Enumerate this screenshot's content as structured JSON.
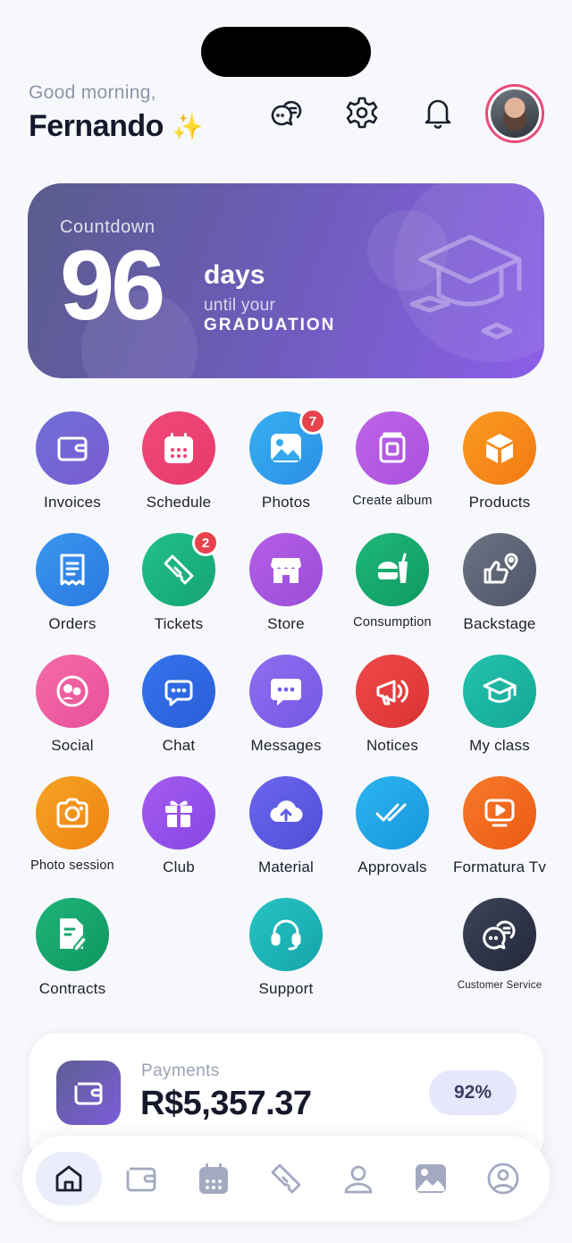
{
  "header": {
    "greeting": "Good morning,",
    "user_name": "Fernando",
    "sparkle": "✨",
    "icons": [
      "chat-bubbles-icon",
      "settings-icon",
      "bell-icon"
    ]
  },
  "countdown": {
    "label": "Countdown",
    "number": "96",
    "unit": "days",
    "until": "until your",
    "event": "GRADUATION"
  },
  "apps": [
    {
      "label": "Invoices",
      "icon": "wallet-icon",
      "color_from": "#6f6fd6",
      "color_to": "#7a5bd2"
    },
    {
      "label": "Schedule",
      "icon": "calendar-icon",
      "color_from": "#f0487a",
      "color_to": "#e83a6b"
    },
    {
      "label": "Photos",
      "icon": "image-icon",
      "color_from": "#35b0f1",
      "color_to": "#2c8ee6",
      "badge": "7"
    },
    {
      "label": "Create album",
      "icon": "album-icon",
      "color_from": "#c064e8",
      "color_to": "#a851dc"
    },
    {
      "label": "Products",
      "icon": "box-icon",
      "color_from": "#fb9a22",
      "color_to": "#f27a12"
    },
    {
      "label": "Orders",
      "icon": "receipt-icon",
      "color_from": "#3a97ef",
      "color_to": "#2b78e0"
    },
    {
      "label": "Tickets",
      "icon": "ticket-icon",
      "color_from": "#22c08a",
      "color_to": "#15a472",
      "badge": "2"
    },
    {
      "label": "Store",
      "icon": "storefront-icon",
      "color_from": "#b55ee6",
      "color_to": "#9a4ed8"
    },
    {
      "label": "Consumption",
      "icon": "food-icon",
      "color_from": "#1fb77a",
      "color_to": "#0f9a62"
    },
    {
      "label": "Backstage",
      "icon": "thumbs-location-icon",
      "color_from": "#6c7384",
      "color_to": "#4e5566"
    },
    {
      "label": "Social",
      "icon": "social-icon",
      "color_from": "#f56ba8",
      "color_to": "#e8509a"
    },
    {
      "label": "Chat",
      "icon": "chat-icon",
      "color_from": "#3474ec",
      "color_to": "#2a5ed8"
    },
    {
      "label": "Messages",
      "icon": "message-icon",
      "color_from": "#8f6df0",
      "color_to": "#7458e4"
    },
    {
      "label": "Notices",
      "icon": "megaphone-icon",
      "color_from": "#f04848",
      "color_to": "#d93434"
    },
    {
      "label": "My class",
      "icon": "graduation-cap-icon",
      "color_from": "#22c2ad",
      "color_to": "#15a894"
    },
    {
      "label": "Photo session",
      "icon": "camera-icon",
      "color_from": "#f7a424",
      "color_to": "#ee8212"
    },
    {
      "label": "Club",
      "icon": "gift-icon",
      "color_from": "#a45cf0",
      "color_to": "#8746e4"
    },
    {
      "label": "Material",
      "icon": "cloud-upload-icon",
      "color_from": "#6b66ee",
      "color_to": "#4f4fd6"
    },
    {
      "label": "Approvals",
      "icon": "double-check-icon",
      "color_from": "#2bb4f0",
      "color_to": "#1896dc"
    },
    {
      "label": "Formatura Tv",
      "icon": "tv-play-icon",
      "color_from": "#f97a2a",
      "color_to": "#ea5a14"
    },
    {
      "label": "Contracts",
      "icon": "contract-icon",
      "color_from": "#1fb579",
      "color_to": "#0f9560"
    },
    {
      "label": "Support",
      "icon": "headset-icon",
      "color_from": "#27c3c3",
      "color_to": "#14a5ac"
    },
    {
      "label": "Customer Service",
      "icon": "customer-service-icon",
      "color_from": "#3d4458",
      "color_to": "#23283a"
    }
  ],
  "payments": {
    "label": "Payments",
    "amount": "R$5,357.37",
    "percent": "92%",
    "percent_value": 0.92
  },
  "tabbar": {
    "items": [
      "home-icon",
      "wallet-icon",
      "calendar-icon",
      "ticket-icon",
      "community-icon",
      "gallery-icon",
      "profile-icon"
    ],
    "active": "home-icon"
  },
  "colors": {
    "accent": "#6b5cb6",
    "badge": "#e8424c",
    "text": "#16182b",
    "muted": "#8e95a8"
  }
}
